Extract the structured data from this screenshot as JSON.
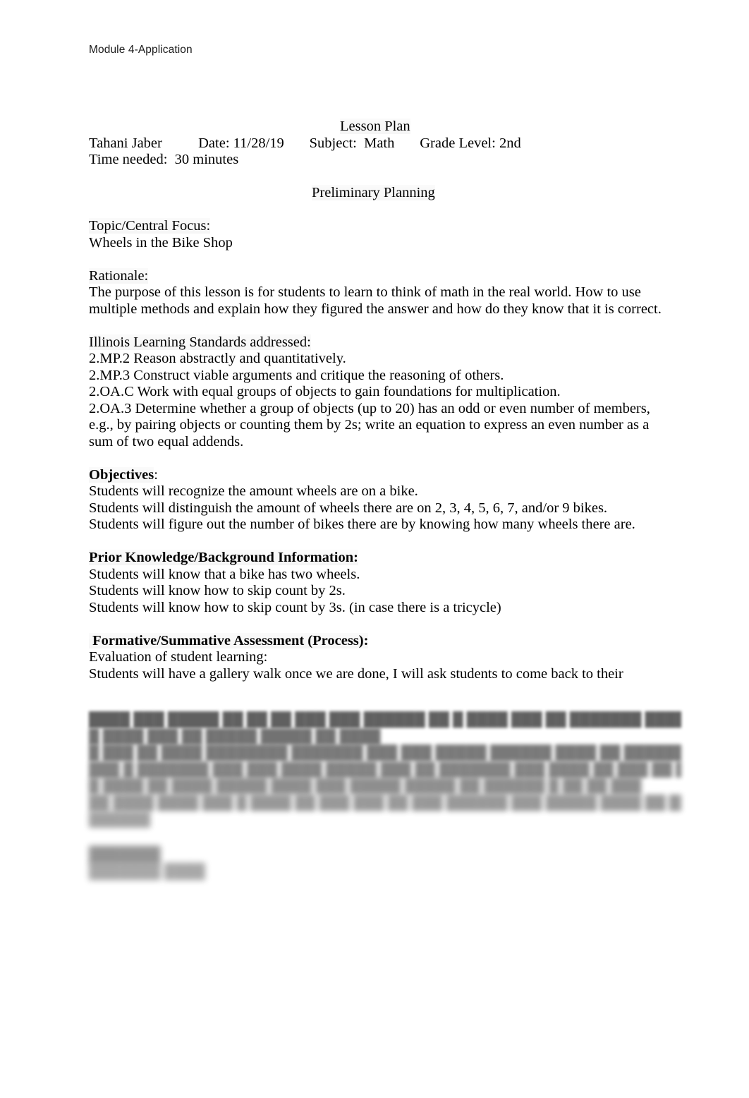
{
  "document": {
    "running_head": "Module 4-Application",
    "title": "Lesson Plan",
    "section_title": "Preliminary Planning"
  },
  "header_fields": {
    "author": "Tahani Jaber",
    "date": "Date: 11/28/19",
    "subject": "Subject:  Math",
    "grade_level": "Grade Level: 2nd",
    "time_needed": "Time needed:  30 minutes"
  },
  "sections": {
    "topic": {
      "heading": "Topic/Central Focus:",
      "lines": [
        "Wheels in the Bike Shop"
      ]
    },
    "rationale": {
      "heading": "Rationale:",
      "lines": [
        "The purpose of this lesson is for students to learn to think of math in the real world. How to use multiple methods and explain how they figured the answer and how do they know that it is correct."
      ]
    },
    "standards": {
      "heading": "Illinois Learning Standards addressed:",
      "lines": [
        "2.MP.2 Reason abstractly and quantitatively.",
        "2.MP.3 Construct viable arguments and critique the reasoning of others.",
        "2.OA.C Work with equal groups of objects to gain foundations for multiplication.",
        "2.OA.3 Determine whether a group of objects (up to 20) has an odd or even number of members, e.g., by pairing objects or counting them by 2s; write an equation to express an even number as a sum of two equal addends."
      ]
    },
    "objectives": {
      "heading": "Objectives",
      "heading_suffix": ":",
      "lines": [
        "Students will recognize the amount wheels are on a bike.",
        "Students will distinguish the amount of wheels there are on 2, 3, 4, 5, 6, 7, and/or 9 bikes.",
        "Students will figure out the number of bikes there are by knowing how many wheels there are."
      ]
    },
    "prior_knowledge": {
      "heading": "Prior Knowledge/Background Information:",
      "lines": [
        "Students will know that a bike has two wheels.",
        "Students will know how to skip count by 2s.",
        "Students will know how to skip count by 3s. (in case there is a tricycle)"
      ]
    },
    "assessment": {
      "heading": " Formative/Summative Assessment (Process):",
      "lines": [
        "Evaluation of student learning:",
        "Students will have a gallery walk once we are done, I will ask students to come back to their"
      ]
    }
  },
  "illegible": {
    "note": "blurred-unreadable-text",
    "lines": [
      "████ ███ █████ ██ ██ ██ ███ ███ ██████ ██ █ ████ ███ ██ ███████ ███████",
      "█ ████ ███ ██ █████ █████ ██ ████",
      "█ ███ ██ ████ ████████ ███████ ███ ███ █████ ██████ ████ ██ ████████  ████ ███ █████",
      "███ █ ███████ ███ ███ ████ █████ ███ ██ ███████ ███ ████ ██ ███ ██ ███ ███████",
      "█ ████ ██ ████ █████ ████ ███ █████ █████ ██  ██████ █ ██ ██ ███",
      "██ ████ ████ ███ █ ████ ██ ███ ███ ██ ███ ██████   ███ █████ ████ ██ ███ ██████ ██ ███",
      "██████"
    ],
    "tail_heading": "███████",
    "tail_line": "███████ ████"
  }
}
